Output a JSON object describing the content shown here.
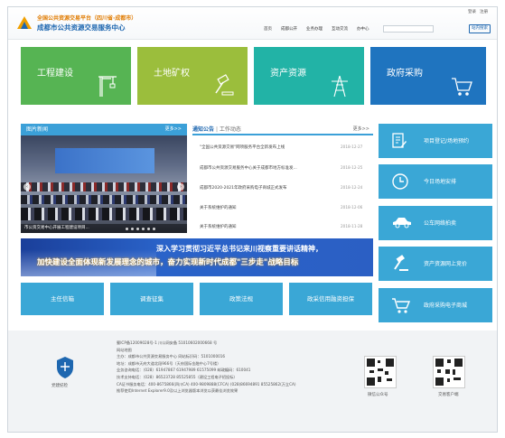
{
  "header": {
    "title_line1": "全国公共资源交易平台（四川省·成都市）",
    "title_line2": "成都市公共资源交易服务中心",
    "top_links": [
      "登录",
      "注册"
    ],
    "nav": [
      "首页",
      "成都公开",
      "业务办理",
      "互动交流",
      "办中心"
    ],
    "search_button": "站内搜索"
  },
  "tiles": [
    {
      "label": "工程建设",
      "color": "#56b453",
      "icon": "crane-icon"
    },
    {
      "label": "土地矿权",
      "color": "#9bbe3c",
      "icon": "gavel-icon"
    },
    {
      "label": "资产资源",
      "color": "#22b3a6",
      "icon": "tower-icon"
    },
    {
      "label": "政府采购",
      "color": "#1f74bf",
      "icon": "cart-icon"
    }
  ],
  "photo_news": {
    "title": "图片新闻",
    "more": "更多>>",
    "caption": "市公资交易中心开展工程建设项目..."
  },
  "notices": {
    "tab_active": "通知公告",
    "tab_sep": "|",
    "tab_other": "工作动态",
    "more": "更多>>",
    "items": [
      {
        "title": "\"全国公共资源交易\"网项服务平台全新发布上线",
        "date": "2018-12-27"
      },
      {
        "title": "成都市公共资源交易服务中心关于成都市地方标准发...",
        "date": "2018-12-25"
      },
      {
        "title": "成都市2020-2021年政府采购电子商城正式发布",
        "date": "2018-12-24"
      },
      {
        "title": "关于系统维护的通知",
        "date": "2018-12-06"
      },
      {
        "title": "关于系统维护的通知",
        "date": "2018-11-28"
      }
    ]
  },
  "side_buttons": [
    {
      "label": "项目登记/场地预约",
      "icon": "register-icon"
    },
    {
      "label": "今日场地安排",
      "icon": "clock-icon"
    },
    {
      "label": "公车网络拍卖",
      "icon": "car-icon"
    },
    {
      "label": "资产资源网上竞价",
      "icon": "hammer-icon"
    },
    {
      "label": "政府采购电子商城",
      "icon": "cart-icon"
    }
  ],
  "banner": {
    "line1": "深入学习贯彻习近平总书记来川视察重要讲话精神，",
    "line2": "加快建设全面体现新发展理念的城市，奋力实现新时代成都\"三步走\"战略目标"
  },
  "bottom_buttons": [
    "主任信箱",
    "调查征集",
    "政策法规",
    "政采信用融资担保"
  ],
  "footer": {
    "badge_label": "党建纪检",
    "lines": [
      "蜀ICP备12009028号-1   川公网安备 51010602000668 号",
      "网站地图",
      "主办：成都市公共资源交易服务中心  网站标识码：5101000016",
      "地址：成都市天府大道北段966号（天府国际金融中心7号楼）",
      "业务咨询电话：（028）61947867  61947989  61575099  邮政编码：610041",
      "技术支持电话：（028）86523728  85525855（建设工程电子招投标）",
      "CA证书服务电话：400-8675866(四川CA)  400-9809888(CFCA)  (028)86694891  85525862(万立CA)",
      "推荐使用Internet Explorer9.0及以上浏览器版本浏览以获最佳浏览效果"
    ],
    "qr1_label": "微信公众号",
    "qr2_label": "交易客户端"
  }
}
